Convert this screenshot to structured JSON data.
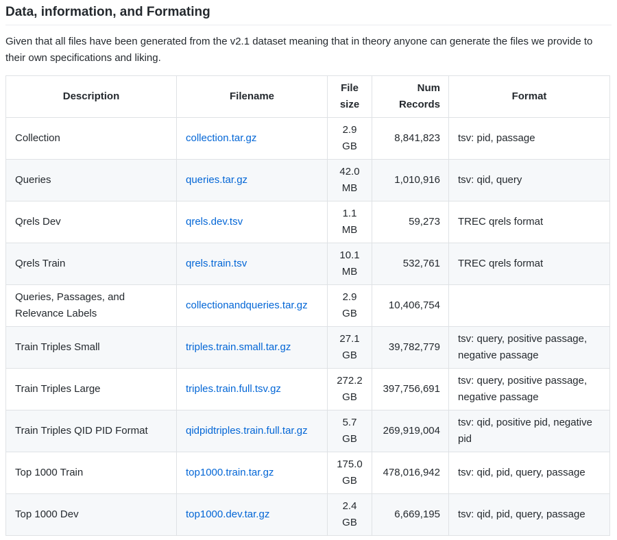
{
  "heading": "Data, information, and Formating",
  "intro": "Given that all files have been generated from the v2.1 dataset meaning that in theory anyone can generate the files we provide to their own specifications and liking.",
  "table": {
    "headers": {
      "description": "Description",
      "filename": "Filename",
      "size_line1": "File",
      "size_line2": "size",
      "num_line1": "Num",
      "num_line2": "Records",
      "format": "Format"
    },
    "rows": [
      {
        "description": "Collection",
        "filename": "collection.tar.gz",
        "size": "2.9",
        "unit": "GB",
        "records": "8,841,823",
        "format": "tsv: pid, passage"
      },
      {
        "description": "Queries",
        "filename": "queries.tar.gz",
        "size": "42.0",
        "unit": "MB",
        "records": "1,010,916",
        "format": "tsv: qid, query"
      },
      {
        "description": "Qrels Dev",
        "filename": "qrels.dev.tsv",
        "size": "1.1",
        "unit": "MB",
        "records": "59,273",
        "format": "TREC qrels format"
      },
      {
        "description": "Qrels Train",
        "filename": "qrels.train.tsv",
        "size": "10.1",
        "unit": "MB",
        "records": "532,761",
        "format": "TREC qrels format"
      },
      {
        "description": "Queries, Passages, and Relevance Labels",
        "filename": "collectionandqueries.tar.gz",
        "size": "2.9",
        "unit": "GB",
        "records": "10,406,754",
        "format": ""
      },
      {
        "description": "Train Triples Small",
        "filename": "triples.train.small.tar.gz",
        "size": "27.1",
        "unit": "GB",
        "records": "39,782,779",
        "format": "tsv: query, positive passage, negative passage"
      },
      {
        "description": "Train Triples Large",
        "filename": "triples.train.full.tsv.gz",
        "size": "272.2",
        "unit": "GB",
        "records": "397,756,691",
        "format": "tsv: query, positive passage, negative passage"
      },
      {
        "description": "Train Triples QID PID Format",
        "filename": "qidpidtriples.train.full.tar.gz",
        "size": "5.7",
        "unit": "GB",
        "records": "269,919,004",
        "format": "tsv: qid, positive pid, negative pid"
      },
      {
        "description": "Top 1000 Train",
        "filename": "top1000.train.tar.gz",
        "size": "175.0",
        "unit": "GB",
        "records": "478,016,942",
        "format": "tsv: qid, pid, query, passage"
      },
      {
        "description": "Top 1000 Dev",
        "filename": "top1000.dev.tar.gz",
        "size": "2.4",
        "unit": "GB",
        "records": "6,669,195",
        "format": "tsv: qid, pid, query, passage"
      }
    ]
  }
}
